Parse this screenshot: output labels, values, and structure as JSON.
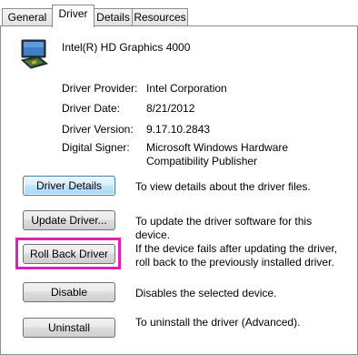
{
  "tabs": [
    {
      "label": "General"
    },
    {
      "label": "Driver"
    },
    {
      "label": "Details"
    },
    {
      "label": "Resources"
    }
  ],
  "active_tab": "Driver",
  "device": {
    "name": "Intel(R) HD Graphics 4000",
    "icon": "display-adapter-icon"
  },
  "info": [
    {
      "label": "Driver Provider:",
      "value": "Intel Corporation"
    },
    {
      "label": "Driver Date:",
      "value": "8/21/2012"
    },
    {
      "label": "Driver Version:",
      "value": "9.17.10.2843"
    },
    {
      "label": "Digital Signer:",
      "value": "Microsoft Windows Hardware Compatibility Publisher"
    }
  ],
  "actions": [
    {
      "button": "Driver Details",
      "description": "To view details about the driver files."
    },
    {
      "button": "Update Driver...",
      "description": "To update the driver software for this device."
    },
    {
      "button": "Roll Back Driver",
      "description": "If the device fails after updating the driver, roll back to the previously installed driver."
    },
    {
      "button": "Disable",
      "description": "Disables the selected device."
    },
    {
      "button": "Uninstall",
      "description": "To uninstall the driver (Advanced)."
    }
  ],
  "highlight_color": "#e11fb1",
  "highlighted_action": "Roll Back Driver"
}
